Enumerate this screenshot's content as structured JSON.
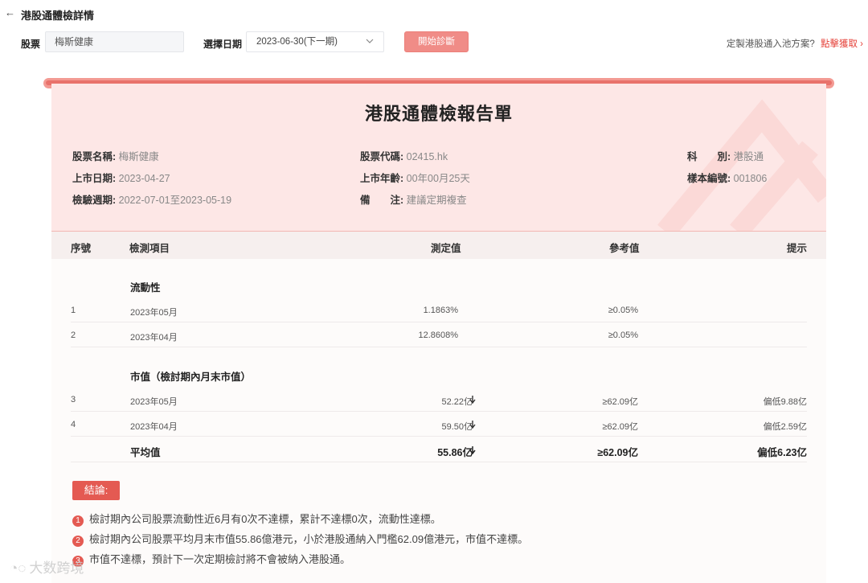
{
  "header": {
    "back_icon": "back-arrow-icon",
    "title": "港股通體檢詳情"
  },
  "filters": {
    "stock_label": "股票",
    "stock_value": "梅斯健康",
    "date_label": "選擇日期",
    "date_value": "2023-06-30(下一期)",
    "start_button": "開始診斷",
    "promo_text": "定製港股通入池方案?",
    "promo_link": "點擊獲取"
  },
  "report": {
    "title": "港股通體檢報告單",
    "info": {
      "name_label": "股票名稱:",
      "name": "梅斯健康",
      "code_label": "股票代碼:",
      "code": "02415.hk",
      "category_label": "科　　別:",
      "category": "港股通",
      "listing_label": "上市日期:",
      "listing": "2023-04-27",
      "age_label": "上市年齡:",
      "age": "00年00月25天",
      "sample_label": "樣本編號:",
      "sample": "001806",
      "period_label": "檢驗週期:",
      "period": "2022-07-01至2023-05-19",
      "remark_label": "備　　注:",
      "remark": "建議定期複查"
    },
    "columns": [
      "序號",
      "檢測項目",
      "測定值",
      "參考值",
      "提示"
    ],
    "sections": [
      {
        "title": "流動性",
        "rows": [
          {
            "no": "1",
            "item": "2023年05月",
            "value": "1.1863%",
            "ref": "≥0.05%",
            "hint": ""
          },
          {
            "no": "2",
            "item": "2023年04月",
            "value": "12.8608%",
            "ref": "≥0.05%",
            "hint": ""
          }
        ]
      },
      {
        "title": "市值（檢討期內月末市值）",
        "rows": [
          {
            "no": "3",
            "item": "2023年05月",
            "value": "52.22亿",
            "ref": "≥62.09亿",
            "hint": "偏低9.88亿"
          },
          {
            "no": "4",
            "item": "2023年04月",
            "value": "59.50亿",
            "ref": "≥62.09亿",
            "hint": "偏低2.59亿"
          }
        ],
        "average": {
          "label": "平均值",
          "value": "55.86亿",
          "ref": "≥62.09亿",
          "hint": "偏低6.23亿"
        }
      }
    ],
    "conclusion": {
      "label": "結論:",
      "items": [
        {
          "no": "1",
          "text": "檢討期內公司股票流動性近6月有0次不達標，累計不達標0次，流動性達標。"
        },
        {
          "no": "2",
          "text": "檢討期內公司股票平均月末市值55.86億港元，小於港股通納入門檻62.09億港元，市值不達標。"
        },
        {
          "no": "3",
          "text": "市值不達標，預計下一次定期檢討將不會被納入港股通。"
        }
      ]
    }
  },
  "watermark": {
    "text": "大数跨境"
  },
  "colors": {
    "accent": "#e45a52",
    "header_bg": "#fde7e6",
    "button": "#f08c87"
  }
}
